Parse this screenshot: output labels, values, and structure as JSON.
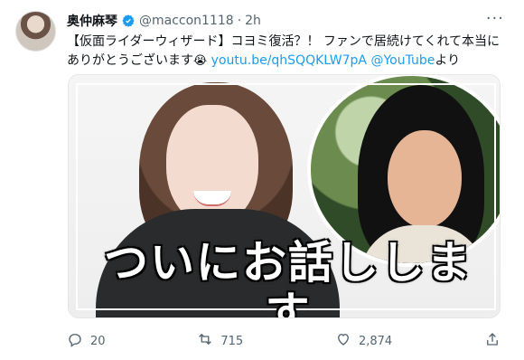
{
  "author": {
    "display_name": "奥仲麻琴",
    "handle": "@maccon1118",
    "time": "2h"
  },
  "tweet": {
    "text_lead": "【仮面ライダーウィザード】コヨミ復活？！ ファンで居続けてくれて本当にありがとうございます",
    "emoji": "😭",
    "link_text": "youtu.be/qhSQQKLW7pA",
    "mention": "@YouTube",
    "suffix": "より"
  },
  "media": {
    "caption": "ついにお話しします"
  },
  "actions": {
    "reply_count": "20",
    "retweet_count": "715",
    "like_count": "2,874"
  },
  "colors": {
    "link": "#1d9bf0",
    "muted": "#536471",
    "verified": "#1d9bf0"
  },
  "icons": {
    "verified": "verified-badge-icon",
    "more": "more-options-icon",
    "reply": "reply-icon",
    "retweet": "retweet-icon",
    "like": "heart-icon",
    "share": "share-icon"
  }
}
